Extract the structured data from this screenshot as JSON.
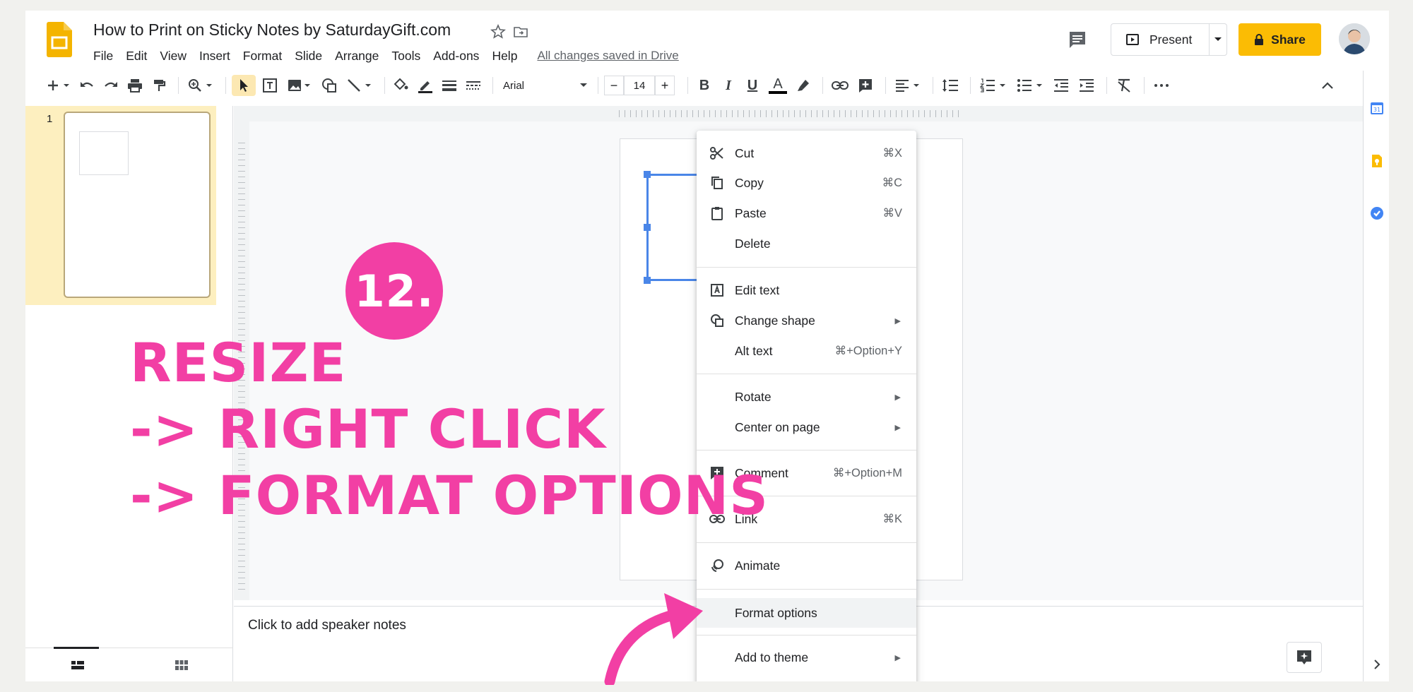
{
  "header": {
    "doc_title": "How to Print on Sticky Notes by SaturdayGift.com",
    "menu": [
      "File",
      "Edit",
      "View",
      "Insert",
      "Format",
      "Slide",
      "Arrange",
      "Tools",
      "Add-ons",
      "Help"
    ],
    "save_status": "All changes saved in Drive",
    "present_label": "Present",
    "share_label": "Share"
  },
  "toolbar": {
    "font_name": "Arial",
    "font_size": "14",
    "minus": "−",
    "plus": "+",
    "bold": "B",
    "italic": "I",
    "underline": "U",
    "text_color": "A"
  },
  "filmstrip": {
    "slide_number": "1"
  },
  "notes": {
    "placeholder": "Click to add speaker notes"
  },
  "context_menu": {
    "items": [
      {
        "label": "Cut",
        "shortcut": "⌘X",
        "icon": "scissors-icon"
      },
      {
        "label": "Copy",
        "shortcut": "⌘C",
        "icon": "copy-icon"
      },
      {
        "label": "Paste",
        "shortcut": "⌘V",
        "icon": "clipboard-icon"
      },
      {
        "label": "Delete",
        "shortcut": ""
      },
      {
        "label": "Edit text",
        "shortcut": "",
        "icon": "text-box-icon"
      },
      {
        "label": "Change shape",
        "shortcut": "",
        "icon": "shape-icon",
        "submenu": true
      },
      {
        "label": "Alt text",
        "shortcut": "⌘+Option+Y"
      },
      {
        "label": "Rotate",
        "shortcut": "",
        "submenu": true
      },
      {
        "label": "Center on page",
        "shortcut": "",
        "submenu": true
      },
      {
        "label": "Comment",
        "shortcut": "⌘+Option+M",
        "icon": "add-comment-icon"
      },
      {
        "label": "Link",
        "shortcut": "⌘K",
        "icon": "link-icon"
      },
      {
        "label": "Animate",
        "shortcut": "",
        "icon": "animate-icon"
      },
      {
        "label": "Format options",
        "shortcut": ""
      },
      {
        "label": "Add to theme",
        "shortcut": "",
        "submenu": true
      }
    ]
  },
  "annotation": {
    "step": "12.",
    "lines": [
      "RESIZE",
      "-> RIGHT CLICK",
      "-> FORMAT OPTIONS"
    ]
  },
  "colors": {
    "accent_pink": "#f23fa4",
    "share_yellow": "#fbbc04",
    "selection_blue": "#4a86e8",
    "filmstrip_highlight": "#fdefbf"
  }
}
